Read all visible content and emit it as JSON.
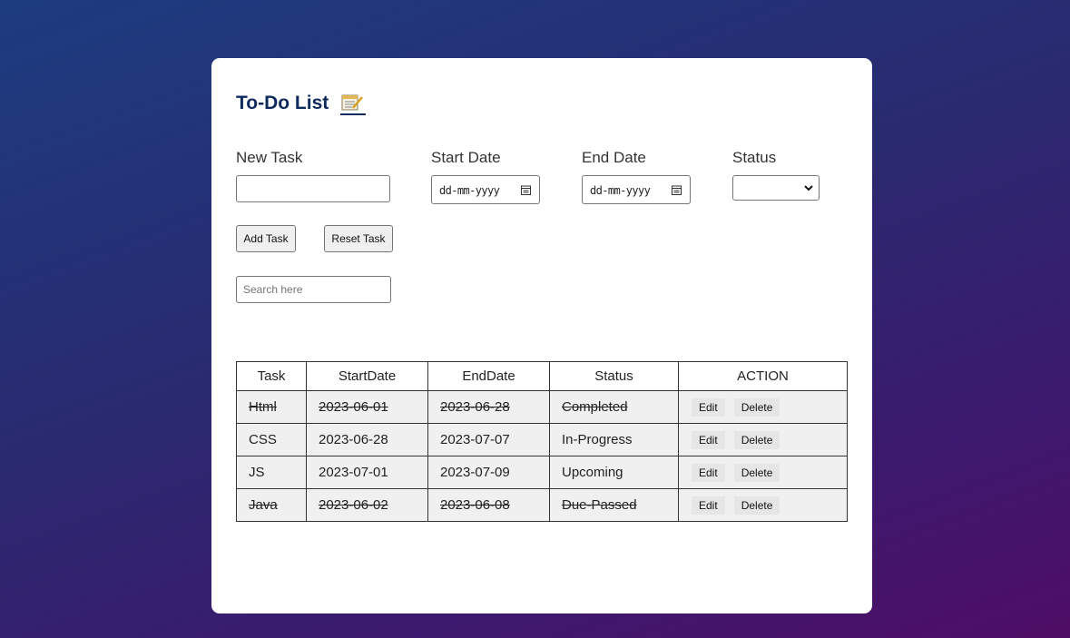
{
  "page": {
    "title": "To-Do List"
  },
  "form": {
    "new_task_label": "New Task",
    "new_task_value": "",
    "start_date_label": "Start Date",
    "start_date_placeholder": "dd-mm-yyyy",
    "end_date_label": "End Date",
    "end_date_placeholder": "dd-mm-yyyy",
    "status_label": "Status",
    "status_selected": "",
    "add_button": "Add Task",
    "reset_button": "Reset Task",
    "search_placeholder": "Search here"
  },
  "table": {
    "headers": [
      "Task",
      "StartDate",
      "EndDate",
      "Status",
      "ACTION"
    ],
    "edit_label": "Edit",
    "delete_label": "Delete",
    "rows": [
      {
        "task": "Html",
        "start": "2023-06-01",
        "end": "2023-06-28",
        "status": "Completed",
        "struck": true
      },
      {
        "task": "CSS",
        "start": "2023-06-28",
        "end": "2023-07-07",
        "status": "In-Progress",
        "struck": false
      },
      {
        "task": "JS",
        "start": "2023-07-01",
        "end": "2023-07-09",
        "status": "Upcoming",
        "struck": false
      },
      {
        "task": "Java",
        "start": "2023-06-02",
        "end": "2023-06-08",
        "status": "Due-Passed",
        "struck": true
      }
    ]
  },
  "icons": {
    "title_icon": "memo-icon",
    "date_icon": "calendar-icon",
    "select_icon": "chevron-down-icon"
  },
  "colors": {
    "title": "#0f2a5c",
    "bg_gradient_start": "#1d3c80",
    "bg_gradient_end": "#4f0d66",
    "row_bg": "#f0f0f0"
  }
}
